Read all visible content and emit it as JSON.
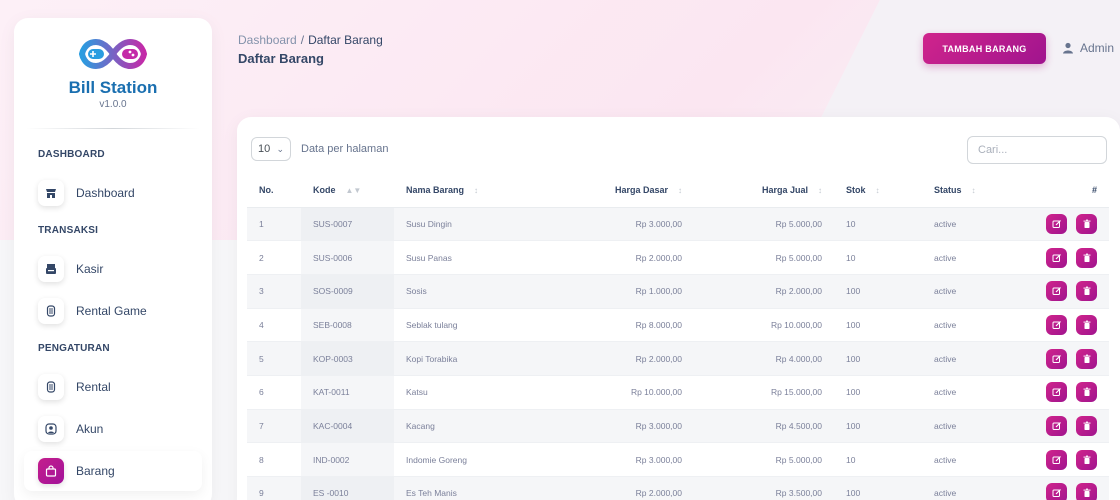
{
  "brand": {
    "name": "Bill Station",
    "version": "v1.0.0",
    "logo_icon": "infinity-gamepad-icon"
  },
  "sidebar": {
    "sections": [
      {
        "title": "DASHBOARD",
        "items": [
          {
            "label": "Dashboard",
            "icon": "store-icon",
            "active": false
          }
        ]
      },
      {
        "title": "TRANSAKSI",
        "items": [
          {
            "label": "Kasir",
            "icon": "cash-register-icon",
            "active": false
          },
          {
            "label": "Rental Game",
            "icon": "gamepad-icon",
            "active": false
          }
        ]
      },
      {
        "title": "PENGATURAN",
        "items": [
          {
            "label": "Rental",
            "icon": "gamepad-icon",
            "active": false
          },
          {
            "label": "Akun",
            "icon": "user-circle-icon",
            "active": false
          },
          {
            "label": "Barang",
            "icon": "shopping-bag-icon",
            "active": true
          }
        ]
      }
    ]
  },
  "header": {
    "breadcrumb_root": "Dashboard",
    "breadcrumb_sep": "/",
    "breadcrumb_current": "Daftar Barang",
    "title": "Daftar Barang",
    "add_button": "TAMBAH BARANG",
    "user_name": "Admin",
    "user_icon": "user-icon"
  },
  "table": {
    "per_page_value": "10",
    "per_page_label": "Data per halaman",
    "search_placeholder": "Cari...",
    "columns": [
      "No.",
      "Kode",
      "Nama Barang",
      "Harga Dasar",
      "Harga Jual",
      "Stok",
      "Status",
      "#"
    ],
    "rows": [
      {
        "no": "1",
        "kode": "SUS-0007",
        "nama": "Susu Dingin",
        "harga_dasar": "Rp 3.000,00",
        "harga_jual": "Rp 5.000,00",
        "stok": "10",
        "status": "active"
      },
      {
        "no": "2",
        "kode": "SUS-0006",
        "nama": "Susu Panas",
        "harga_dasar": "Rp 2.000,00",
        "harga_jual": "Rp 5.000,00",
        "stok": "10",
        "status": "active"
      },
      {
        "no": "3",
        "kode": "SOS-0009",
        "nama": "Sosis",
        "harga_dasar": "Rp 1.000,00",
        "harga_jual": "Rp 2.000,00",
        "stok": "100",
        "status": "active"
      },
      {
        "no": "4",
        "kode": "SEB-0008",
        "nama": "Seblak tulang",
        "harga_dasar": "Rp 8.000,00",
        "harga_jual": "Rp 10.000,00",
        "stok": "100",
        "status": "active"
      },
      {
        "no": "5",
        "kode": "KOP-0003",
        "nama": "Kopi Torabika",
        "harga_dasar": "Rp 2.000,00",
        "harga_jual": "Rp 4.000,00",
        "stok": "100",
        "status": "active"
      },
      {
        "no": "6",
        "kode": "KAT-0011",
        "nama": "Katsu",
        "harga_dasar": "Rp 10.000,00",
        "harga_jual": "Rp 15.000,00",
        "stok": "100",
        "status": "active"
      },
      {
        "no": "7",
        "kode": "KAC-0004",
        "nama": "Kacang",
        "harga_dasar": "Rp 3.000,00",
        "harga_jual": "Rp 4.500,00",
        "stok": "100",
        "status": "active"
      },
      {
        "no": "8",
        "kode": "IND-0002",
        "nama": "Indomie Goreng",
        "harga_dasar": "Rp 3.000,00",
        "harga_jual": "Rp 5.000,00",
        "stok": "10",
        "status": "active"
      },
      {
        "no": "9",
        "kode": "ES -0010",
        "nama": "Es Teh Manis",
        "harga_dasar": "Rp 2.000,00",
        "harga_jual": "Rp 3.500,00",
        "stok": "100",
        "status": "active"
      }
    ]
  },
  "colors": {
    "accent": "#c41e8c",
    "brand_blue": "#1a6fb0",
    "text": "#344767"
  }
}
